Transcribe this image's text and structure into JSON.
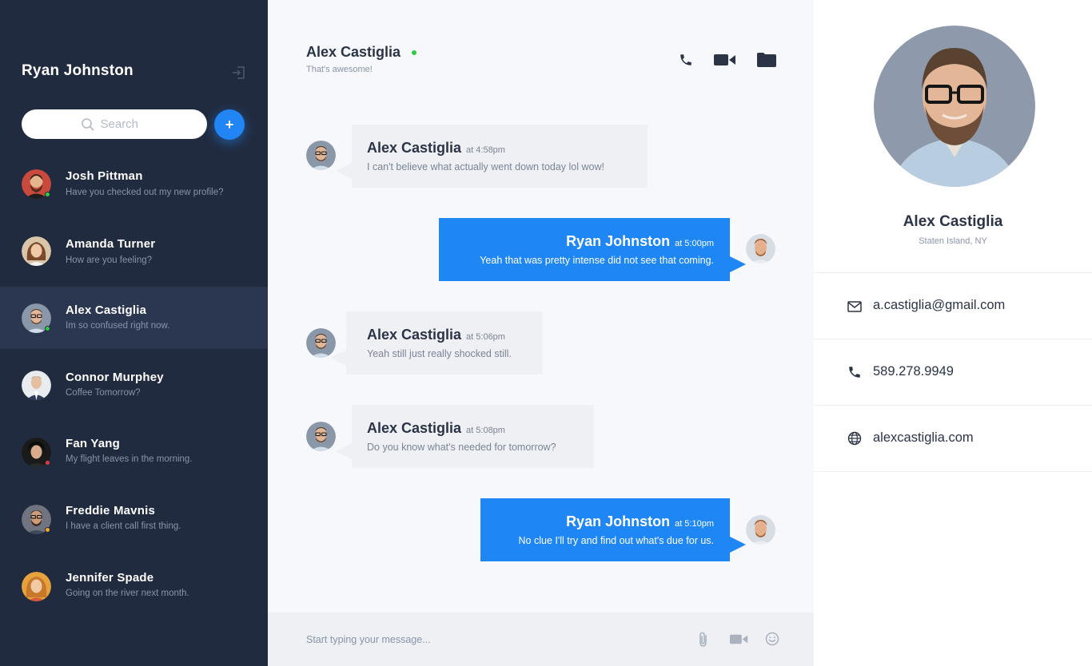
{
  "sidebar": {
    "user_name": "Ryan Johnston",
    "search": {
      "placeholder": "Search"
    },
    "add_button_label": "+",
    "contacts": [
      {
        "name": "Josh Pittman",
        "preview": "Have you checked out my new profile?",
        "status": "online",
        "status_color": "#2ecc40"
      },
      {
        "name": "Amanda Turner",
        "preview": "How are you feeling?",
        "status": "none",
        "status_color": ""
      },
      {
        "name": "Alex Castiglia",
        "preview": "Im so confused right now.",
        "status": "online",
        "status_color": "#2ecc40",
        "active": true
      },
      {
        "name": "Connor Murphey",
        "preview": "Coffee Tomorrow?",
        "status": "none",
        "status_color": ""
      },
      {
        "name": "Fan Yang",
        "preview": "My flight leaves in the morning.",
        "status": "busy",
        "status_color": "#e5373b"
      },
      {
        "name": "Freddie Mavnis",
        "preview": "I have a client call first thing.",
        "status": "away",
        "status_color": "#f5a623"
      },
      {
        "name": "Jennifer Spade",
        "preview": "Going on the river next month.",
        "status": "none",
        "status_color": ""
      }
    ]
  },
  "chat": {
    "contact_name": "Alex Castiglia",
    "contact_status": "That's awesome!",
    "online_color": "#2ecc40",
    "header_icons": [
      "phone-icon",
      "video-camera-icon",
      "folder-icon"
    ],
    "messages": [
      {
        "direction": "in",
        "sender": "Alex Castiglia",
        "time": "at 4:58pm",
        "text": "I can't believe what actually went down today lol wow!"
      },
      {
        "direction": "out",
        "sender": "Ryan Johnston",
        "time": "at 5:00pm",
        "text": "Yeah that was pretty intense did not see that coming."
      },
      {
        "direction": "in",
        "sender": "Alex Castiglia",
        "time": "at 5:06pm",
        "text": "Yeah still just really shocked still."
      },
      {
        "direction": "in",
        "sender": "Alex Castiglia",
        "time": "at 5:08pm",
        "text": "Do you know what's needed for tomorrow?"
      },
      {
        "direction": "out",
        "sender": "Ryan Johnston",
        "time": "at 5:10pm",
        "text": "No clue I'll try and find out what's due for us."
      }
    ],
    "composer": {
      "placeholder": "Start typing your message...",
      "icons": [
        "paperclip-icon",
        "video-camera-icon",
        "smiley-icon"
      ]
    }
  },
  "profile": {
    "name": "Alex Castiglia",
    "location": "Staten Island, NY",
    "email": "a.castiglia@gmail.com",
    "phone": "589.278.9949",
    "website": "alexcastiglia.com"
  },
  "colors": {
    "sidebar_bg": "#212b3f",
    "sidebar_active": "#2b3650",
    "accent_blue": "#1f87f5",
    "incoming_bubble": "#eef0f4",
    "chat_bg": "#f7f8fb"
  }
}
